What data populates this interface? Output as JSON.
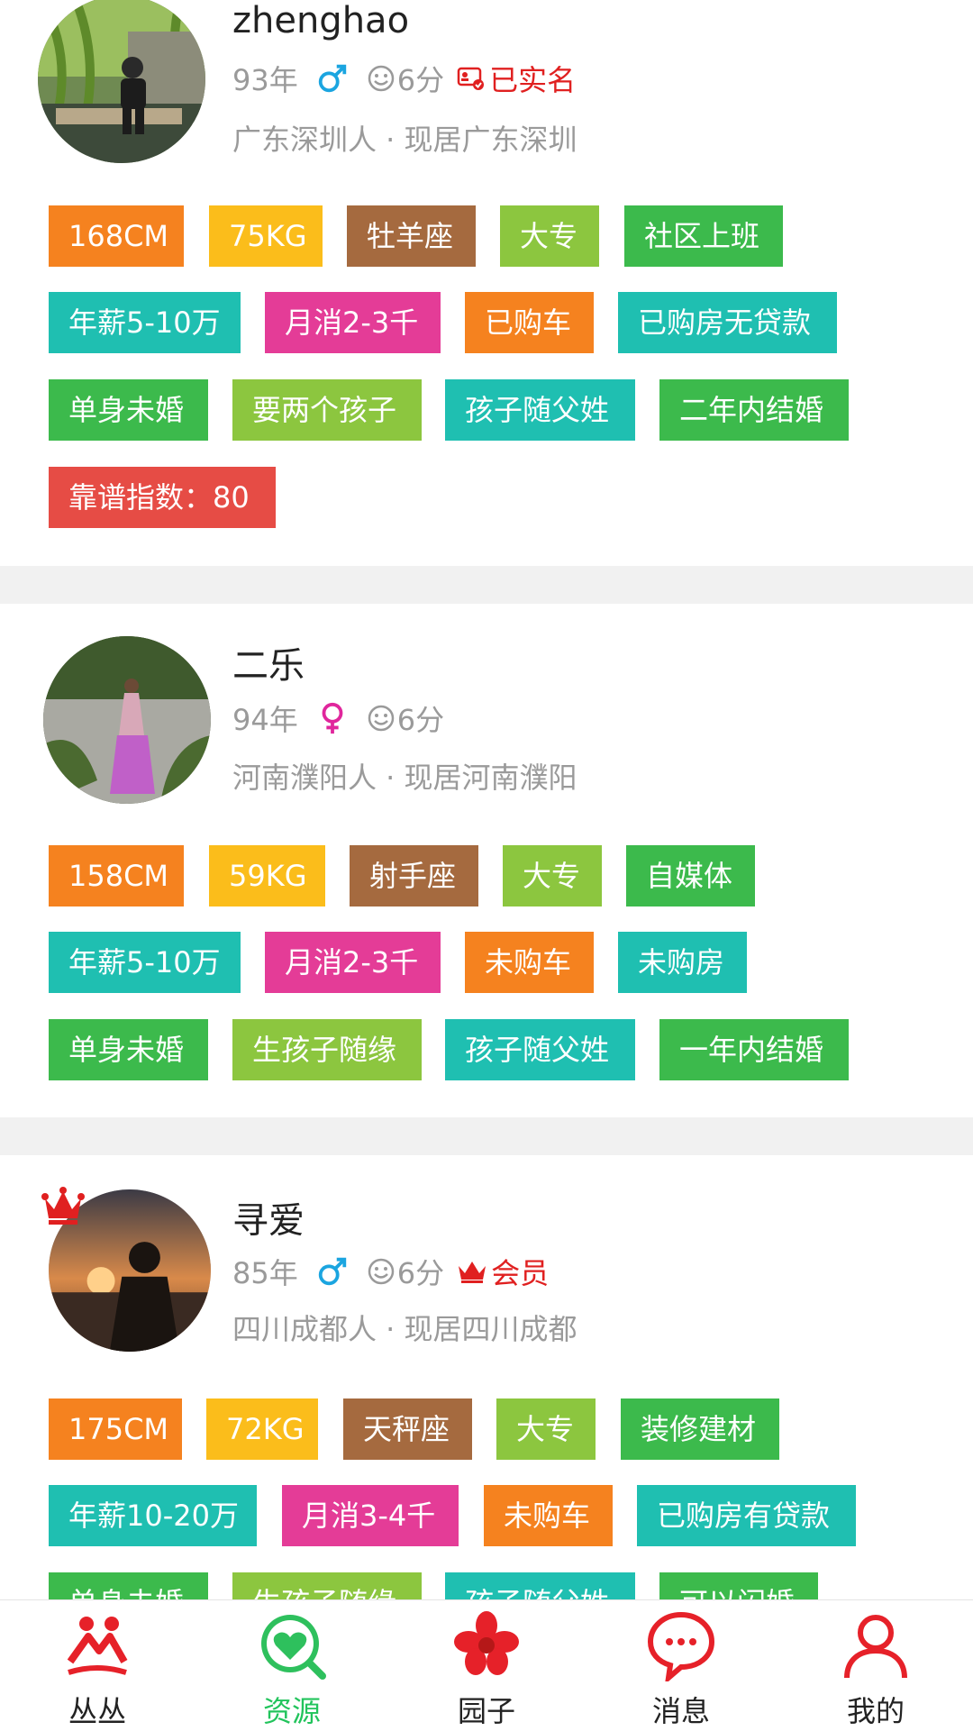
{
  "profiles": [
    {
      "name": "zhenghao",
      "birth_year": "93年",
      "gender": "male",
      "score": "6分",
      "badge": "已实名",
      "location": "广东深圳人 · 现居广东深圳",
      "tags": [
        "168CM",
        "75KG",
        "牡羊座",
        "大专",
        "社区上班",
        "年薪5-10万",
        "月消2-3千",
        "已购车",
        "已购房无贷款",
        "单身未婚",
        "要两个孩子",
        "孩子随父姓",
        "二年内结婚",
        "靠谱指数：80"
      ]
    },
    {
      "name": "二乐",
      "birth_year": "94年",
      "gender": "female",
      "score": "6分",
      "location": "河南濮阳人 · 现居河南濮阳",
      "tags": [
        "158CM",
        "59KG",
        "射手座",
        "大专",
        "自媒体",
        "年薪5-10万",
        "月消2-3千",
        "未购车",
        "未购房",
        "单身未婚",
        "生孩子随缘",
        "孩子随父姓",
        "一年内结婚"
      ]
    },
    {
      "name": "寻爱",
      "birth_year": "85年",
      "gender": "male",
      "score": "6分",
      "badge": "会员",
      "location": "四川成都人 · 现居四川成都",
      "tags": [
        "175CM",
        "72KG",
        "天秤座",
        "大专",
        "装修建材",
        "年薪10-20万",
        "月消3-4千",
        "未购车",
        "已购房有贷款",
        "单身未婚",
        "生孩子随缘",
        "孩子随父姓",
        "可以闪婚"
      ]
    }
  ],
  "tabbar": {
    "items": [
      {
        "label": "丛丛",
        "icon": "couple-icon"
      },
      {
        "label": "资源",
        "icon": "heart-search-icon",
        "active": true
      },
      {
        "label": "园子",
        "icon": "flower-icon"
      },
      {
        "label": "消息",
        "icon": "chat-bubble-icon"
      },
      {
        "label": "我的",
        "icon": "person-icon"
      }
    ]
  },
  "colors": {
    "male": "#1ba5e0",
    "female": "#e0269c",
    "badge_red": "#e02020",
    "active_tab": "#22c45c",
    "brand_red": "#e62129"
  }
}
